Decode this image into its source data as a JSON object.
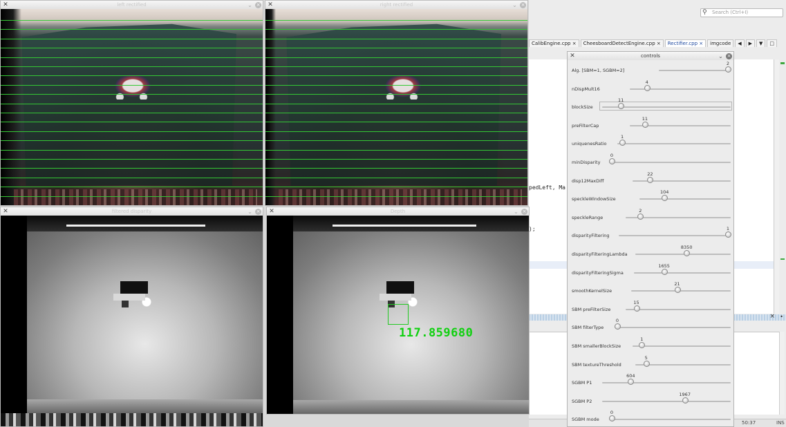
{
  "windows": {
    "left_rectified": {
      "title": "left rectified"
    },
    "right_rectified": {
      "title": "right rectified"
    },
    "filtered_disparity": {
      "title": "filtered disparity"
    },
    "depth": {
      "title": "Depth",
      "distance_readout": "117.859680"
    }
  },
  "ide": {
    "search_placeholder": "Search (Ctrl+I)",
    "tabs": [
      {
        "label": "CalibEngine.cpp"
      },
      {
        "label": "CheesboardDetectEngine.cpp"
      },
      {
        "label": "Rectifier.cpp",
        "active": true
      },
      {
        "label": "imgcode"
      }
    ],
    "code_lines": [
      {
        "text": "pedLeft, Ma"
      },
      {
        "text": ");"
      }
    ],
    "status_position": "50:37",
    "status_mode": "INS"
  },
  "controls": {
    "title": "controls",
    "sliders": [
      {
        "label": "Alg. [SBM=1, SGBM=2]",
        "value": "2",
        "pos": 1.0
      },
      {
        "label": "nDispMult16",
        "value": "4",
        "pos": 0.15
      },
      {
        "label": "blockSize",
        "value": "11",
        "pos": 0.13,
        "boxed": true
      },
      {
        "label": "preFilterCap",
        "value": "11",
        "pos": 0.13
      },
      {
        "label": "uniquenesRatio",
        "value": "1",
        "pos": 0.02
      },
      {
        "label": "minDisparity",
        "value": "0",
        "pos": 0.0
      },
      {
        "label": "disp12MaxDiff",
        "value": "22",
        "pos": 0.16
      },
      {
        "label": "speckleWindowSize",
        "value": "104",
        "pos": 0.26
      },
      {
        "label": "speckleRange",
        "value": "2",
        "pos": 0.12
      },
      {
        "label": "disparityFiltering",
        "value": "1",
        "pos": 1.0
      },
      {
        "label": "disparityFilteringLambda",
        "value": "8350",
        "pos": 0.54
      },
      {
        "label": "disparityFilteringSigma",
        "value": "1655",
        "pos": 0.3
      },
      {
        "label": "smoothKernelSize",
        "value": "21",
        "pos": 0.46
      },
      {
        "label": "SBM preFilterSize",
        "value": "15",
        "pos": 0.08
      },
      {
        "label": "SBM filterType",
        "value": "0",
        "pos": 0.0
      },
      {
        "label": "SBM smallerBlockSize",
        "value": "1",
        "pos": 0.07
      },
      {
        "label": "SBM textureThreshold",
        "value": "5",
        "pos": 0.09
      },
      {
        "label": "SGBM P1",
        "value": "604",
        "pos": 0.21
      },
      {
        "label": "SGBM P2",
        "value": "1967",
        "pos": 0.65
      },
      {
        "label": "SGBM mode",
        "value": "0",
        "pos": 0.0
      }
    ]
  }
}
